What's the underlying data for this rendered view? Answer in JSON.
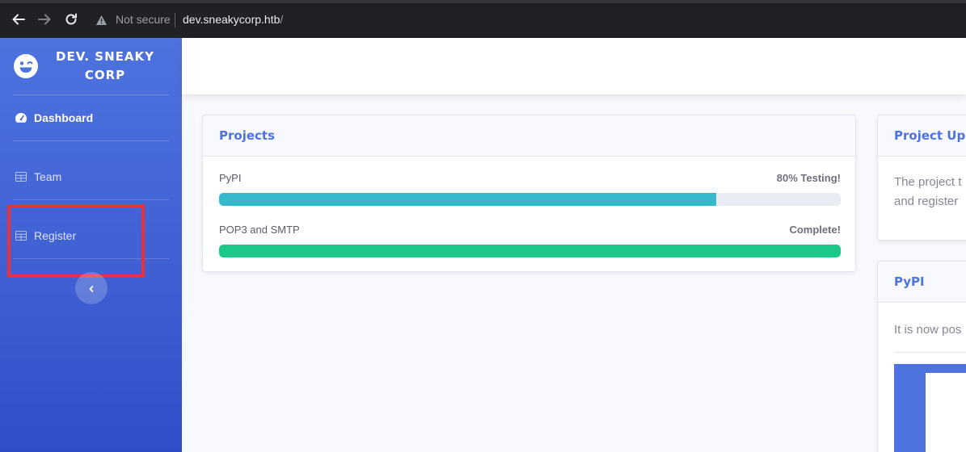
{
  "browser": {
    "security_label": "Not secure",
    "url_host": "dev.sneakycorp.htb",
    "url_path": "/"
  },
  "sidebar": {
    "brand": "DEV. SNEAKY CORP",
    "items": [
      {
        "label": "Dashboard",
        "icon": "tachometer-icon",
        "active": true
      },
      {
        "label": "Team",
        "icon": "table-icon",
        "active": false
      },
      {
        "label": "Register",
        "icon": "table-icon",
        "active": false
      }
    ],
    "toggle_icon": "chevron-left-icon"
  },
  "projects_card": {
    "title": "Projects",
    "items": [
      {
        "name": "PyPI",
        "status": "80% Testing!",
        "progress": 0.8,
        "color": "#36b9cc"
      },
      {
        "name": "POP3 and SMTP",
        "status": "Complete!",
        "progress": 1.0,
        "color": "#1cc88a"
      }
    ]
  },
  "updates_card": {
    "title": "Project Upda",
    "line1": "The project t",
    "line2": "and register"
  },
  "pypi_card": {
    "title": "PyPI",
    "text": "It is now pos"
  },
  "colors": {
    "primary": "#4e73df",
    "highlight": "#e8323b"
  }
}
